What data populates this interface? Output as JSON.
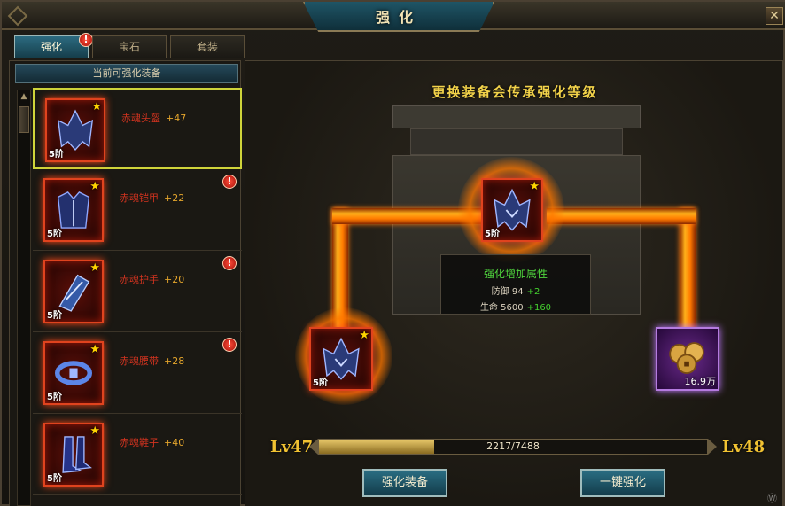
{
  "window": {
    "title": "强化"
  },
  "tabs": [
    {
      "label": "强化",
      "active": true,
      "alert": "!"
    },
    {
      "label": "宝石",
      "active": false
    },
    {
      "label": "套装",
      "active": false
    }
  ],
  "left_panel": {
    "header": "当前可强化装备",
    "items": [
      {
        "name": "赤魂头盔",
        "bonus": "+47",
        "tier": "5阶",
        "selected": true,
        "alert": "",
        "icon": "helmet-icon"
      },
      {
        "name": "赤魂铠甲",
        "bonus": "+22",
        "tier": "5阶",
        "selected": false,
        "alert": "!",
        "icon": "armor-icon"
      },
      {
        "name": "赤魂护手",
        "bonus": "+20",
        "tier": "5阶",
        "selected": false,
        "alert": "!",
        "icon": "gauntlet-icon"
      },
      {
        "name": "赤魂腰带",
        "bonus": "+28",
        "tier": "5阶",
        "selected": false,
        "alert": "!",
        "icon": "belt-icon"
      },
      {
        "name": "赤魂鞋子",
        "bonus": "+40",
        "tier": "5阶",
        "selected": false,
        "alert": "",
        "icon": "boots-icon"
      }
    ]
  },
  "main": {
    "headline": "更换装备会传承强化等级",
    "center_slot": {
      "tier": "5阶",
      "icon": "helmet-icon"
    },
    "left_slot": {
      "tier": "5阶",
      "icon": "helmet-icon"
    },
    "cost_slot": {
      "amount": "16.9万",
      "icon": "coins-icon"
    },
    "info": {
      "title": "强化增加属性",
      "rows": [
        {
          "label": "防御",
          "value": "94",
          "increase": "+2"
        },
        {
          "label": "生命",
          "value": "5600",
          "increase": "+160"
        }
      ]
    },
    "level_from": "Lv47",
    "level_to": "Lv48",
    "progress": {
      "current": 2217,
      "max": 7488,
      "text": "2217/7488"
    },
    "buttons": {
      "enhance": "强化装备",
      "one_key": "一键强化"
    }
  },
  "colors": {
    "accent": "#2c6b80",
    "gold": "#f1c232",
    "red_name": "#d2331f",
    "green": "#44d22f"
  },
  "watermark": "Ⓦ"
}
